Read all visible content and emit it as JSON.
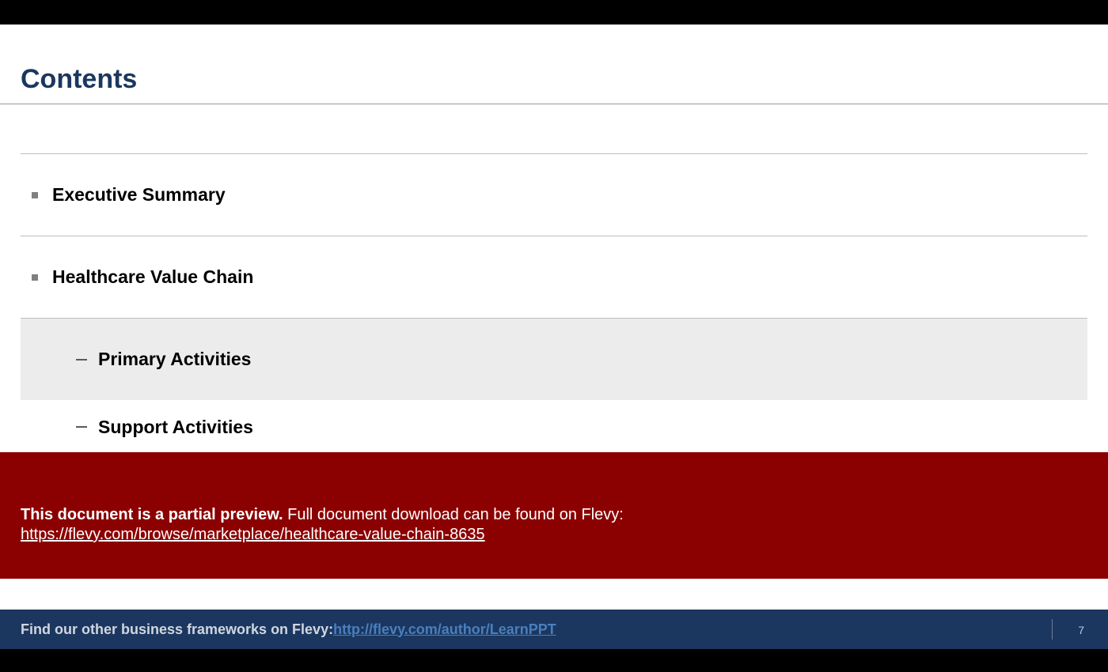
{
  "slide": {
    "title": "Contents"
  },
  "toc": {
    "items": [
      {
        "label": "Executive Summary",
        "level": 1,
        "highlighted": false
      },
      {
        "label": "Healthcare Value Chain",
        "level": 1,
        "highlighted": false
      },
      {
        "label": "Primary Activities",
        "level": 2,
        "highlighted": true
      },
      {
        "label": "Support Activities",
        "level": 2,
        "highlighted": false
      }
    ]
  },
  "previewBanner": {
    "boldPrefix": "This document is a partial preview.",
    "rest": "  Full document download can be found on Flevy:",
    "link": "https://flevy.com/browse/marketplace/healthcare-value-chain-8635"
  },
  "footer": {
    "text": "Find our other business frameworks on Flevy: ",
    "link": "http://flevy.com/author/LearnPPT",
    "pageNumber": "7"
  }
}
